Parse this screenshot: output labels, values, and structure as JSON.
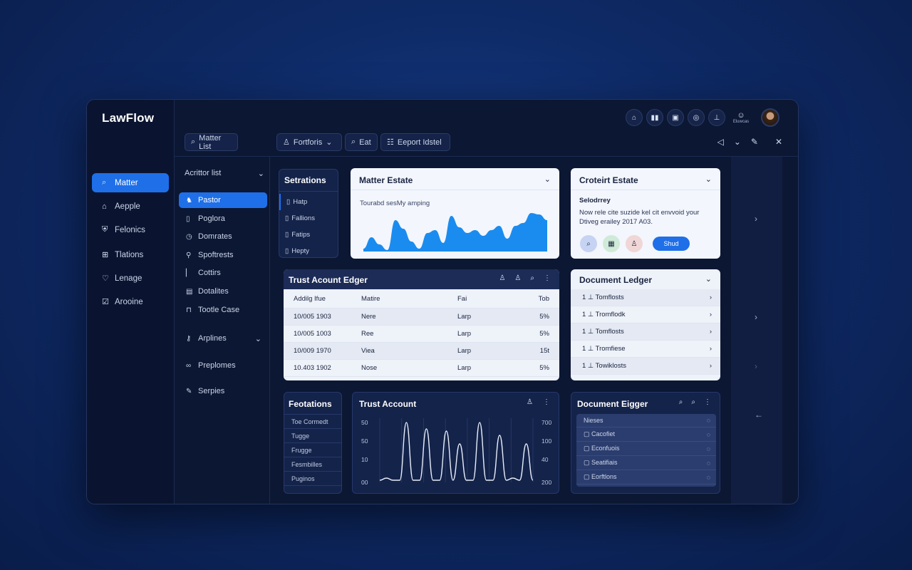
{
  "app": {
    "title": "LawFlow"
  },
  "left_nav": [
    {
      "label": "Matter",
      "icon": "search-icon",
      "active": true
    },
    {
      "label": "Aepple",
      "icon": "home-icon"
    },
    {
      "label": "Felonics",
      "icon": "shield-icon"
    },
    {
      "label": "Tlations",
      "icon": "grid-icon"
    },
    {
      "label": "Lenage",
      "icon": "heart-icon"
    },
    {
      "label": "Arooine",
      "icon": "checkbox-icon"
    }
  ],
  "topbar": {
    "search_label": "Matter List",
    "filter_label": "Fortforis",
    "edit_label": "Eat",
    "report_label": "Eeport Idstel",
    "status_label": "Eluwcas"
  },
  "sub_nav": {
    "header": "Acrittor list",
    "items": [
      {
        "label": "Pastor",
        "icon": "bird-icon",
        "active": true
      },
      {
        "label": "Poglora",
        "icon": "document-icon"
      },
      {
        "label": "Domrates",
        "icon": "clock-icon"
      },
      {
        "label": "Spoftrests",
        "icon": "pin-icon"
      },
      {
        "label": "Cottirs",
        "icon": "bar-icon"
      },
      {
        "label": "Dotalites",
        "icon": "table-icon"
      },
      {
        "label": "Tootle Case",
        "icon": "lock-icon"
      },
      {
        "label": "Arplines",
        "icon": "key-icon"
      },
      {
        "label": "Preplomes",
        "icon": "link-icon"
      },
      {
        "label": "Serpies",
        "icon": "pen-icon"
      }
    ]
  },
  "settings_panel": {
    "title": "Setrations",
    "items": [
      "Hatp",
      "Fallions",
      "Fatips",
      "Hepty"
    ]
  },
  "matter_estate": {
    "title": "Matter Estate",
    "subtitle": "Tourabd sesMy amping",
    "chart_data": {
      "type": "area",
      "values": [
        2,
        10,
        5,
        1,
        22,
        16,
        7,
        2,
        13,
        15,
        6,
        25,
        17,
        13,
        15,
        11,
        15,
        18,
        9,
        18,
        20,
        27,
        26,
        22
      ]
    }
  },
  "crotert_estate": {
    "title": "Croteirt Estate",
    "heading": "Selodrrey",
    "text": "Now rele cite suzide kel cit envvoid your Dtiveg erailey 2017 A03.",
    "button_label": "Shud"
  },
  "trust_ledger": {
    "title": "Trust Acount Edger",
    "columns": [
      "Addilg Ifue",
      "Matire",
      "Fai",
      "Tob"
    ],
    "rows": [
      [
        "10/005 1903",
        "Nere",
        "Larp",
        "5%"
      ],
      [
        "10/005 1003",
        "Ree",
        "Larp",
        "5%"
      ],
      [
        "10/009 1970",
        "Viea",
        "Larp",
        "15t"
      ],
      [
        "10.403 1902",
        "Nose",
        "Larp",
        "5%"
      ]
    ]
  },
  "document_ledger": {
    "title": "Document Ledger",
    "rows": [
      "Tomflosts",
      "Tromflodk",
      "Tomflosts",
      "Tromfiese",
      "Towiklosts"
    ]
  },
  "footnotes": {
    "title": "Feotations",
    "items": [
      "Toe Cormedt",
      "Tugge",
      "Frugge",
      "Fesmbilles",
      "Puginos"
    ]
  },
  "trust_account": {
    "title": "Trust Account",
    "chart_data": {
      "type": "line",
      "y_left_ticks": [
        "50",
        "50",
        "10",
        "00"
      ],
      "y_right_ticks": [
        "700",
        "100",
        "40",
        "200"
      ],
      "values": [
        1,
        2,
        1,
        1,
        28,
        1,
        1,
        25,
        1,
        1,
        24,
        1,
        18,
        1,
        1,
        28,
        1,
        1,
        22,
        1,
        2,
        1,
        18,
        1
      ]
    }
  },
  "doc_ledger_2": {
    "title": "Document Eigger",
    "header": "Nieses",
    "items": [
      "Cacofiet",
      "Econfuois",
      "Seatifiais",
      "Eorftlons"
    ]
  }
}
